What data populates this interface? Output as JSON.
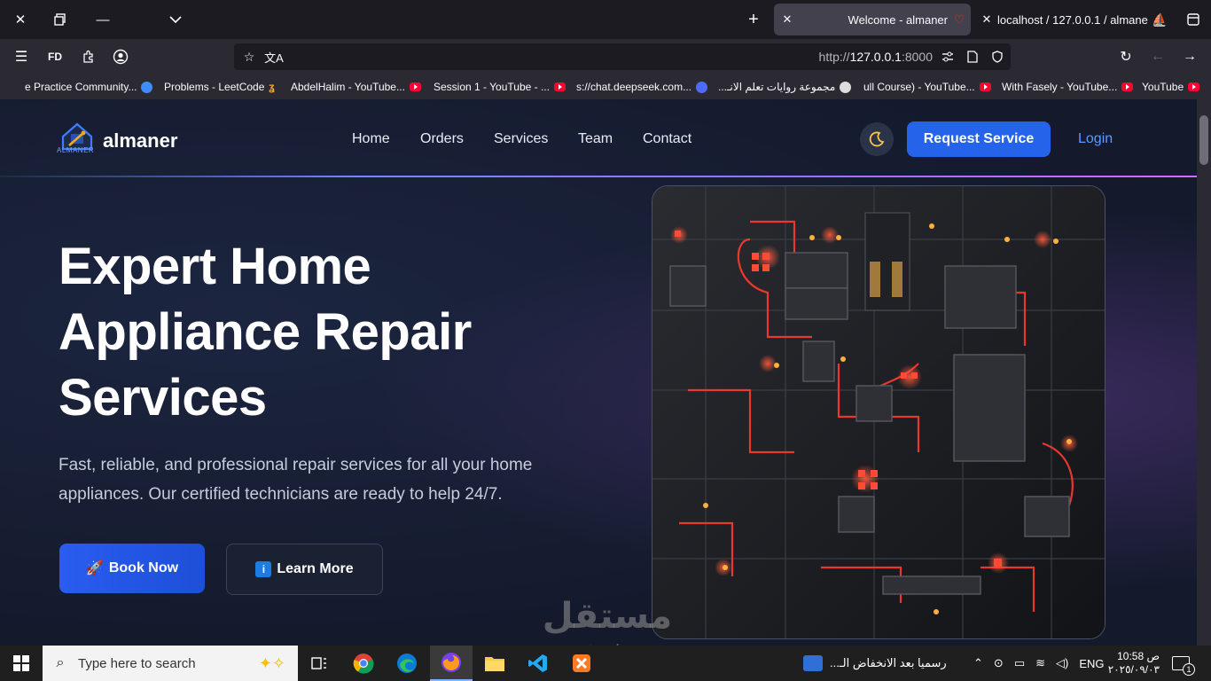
{
  "browser": {
    "tabs": [
      {
        "title": "Welcome - almaner",
        "active": true
      },
      {
        "title": "localhost / 127.0.0.1 / almaner",
        "active": false
      }
    ],
    "url_prefix": "http://",
    "url_host": "127.0.0.1",
    "url_port": ":8000",
    "bookmarks": [
      "e Practice Community...",
      "Problems - LeetCode",
      "AbdelHalim - YouTube...",
      "Session 1 - YouTube - ...",
      "s://chat.deepseek.com...",
      "مجموعة روايات تعلم الانـ...",
      "ull Course) - YouTube...",
      "With Fasely - YouTube...",
      "YouTube"
    ]
  },
  "site": {
    "logo_text": "almaner",
    "logo_sub": "ALMANER",
    "nav": [
      "Home",
      "Orders",
      "Services",
      "Team",
      "Contact"
    ],
    "request_button": "Request Service",
    "login_link": "Login",
    "hero": {
      "title_lines": [
        "Expert Home",
        "Appliance Repair",
        "Services"
      ],
      "subtitle_lines": [
        "Fast, reliable, and professional repair services for all your home",
        "appliances. Our certified technicians are ready to help 24/7."
      ],
      "book_button": "Book Now",
      "book_emoji": "🚀",
      "learn_button": "Learn More",
      "learn_icon": "i"
    }
  },
  "watermark": {
    "arabic": "مستقل",
    "latin": "mostaql.com"
  },
  "taskbar": {
    "search_placeholder": "Type here to search",
    "notification_text": "رسميا بعد الانخفاض الـ...",
    "language": "ENG",
    "time": "10:58 ص",
    "date": "٢٠٢٥/٠٩/٠٣",
    "notification_count": "1"
  },
  "colors": {
    "accent": "#2563eb",
    "login": "#5b9bff",
    "background": "#141a2c"
  }
}
